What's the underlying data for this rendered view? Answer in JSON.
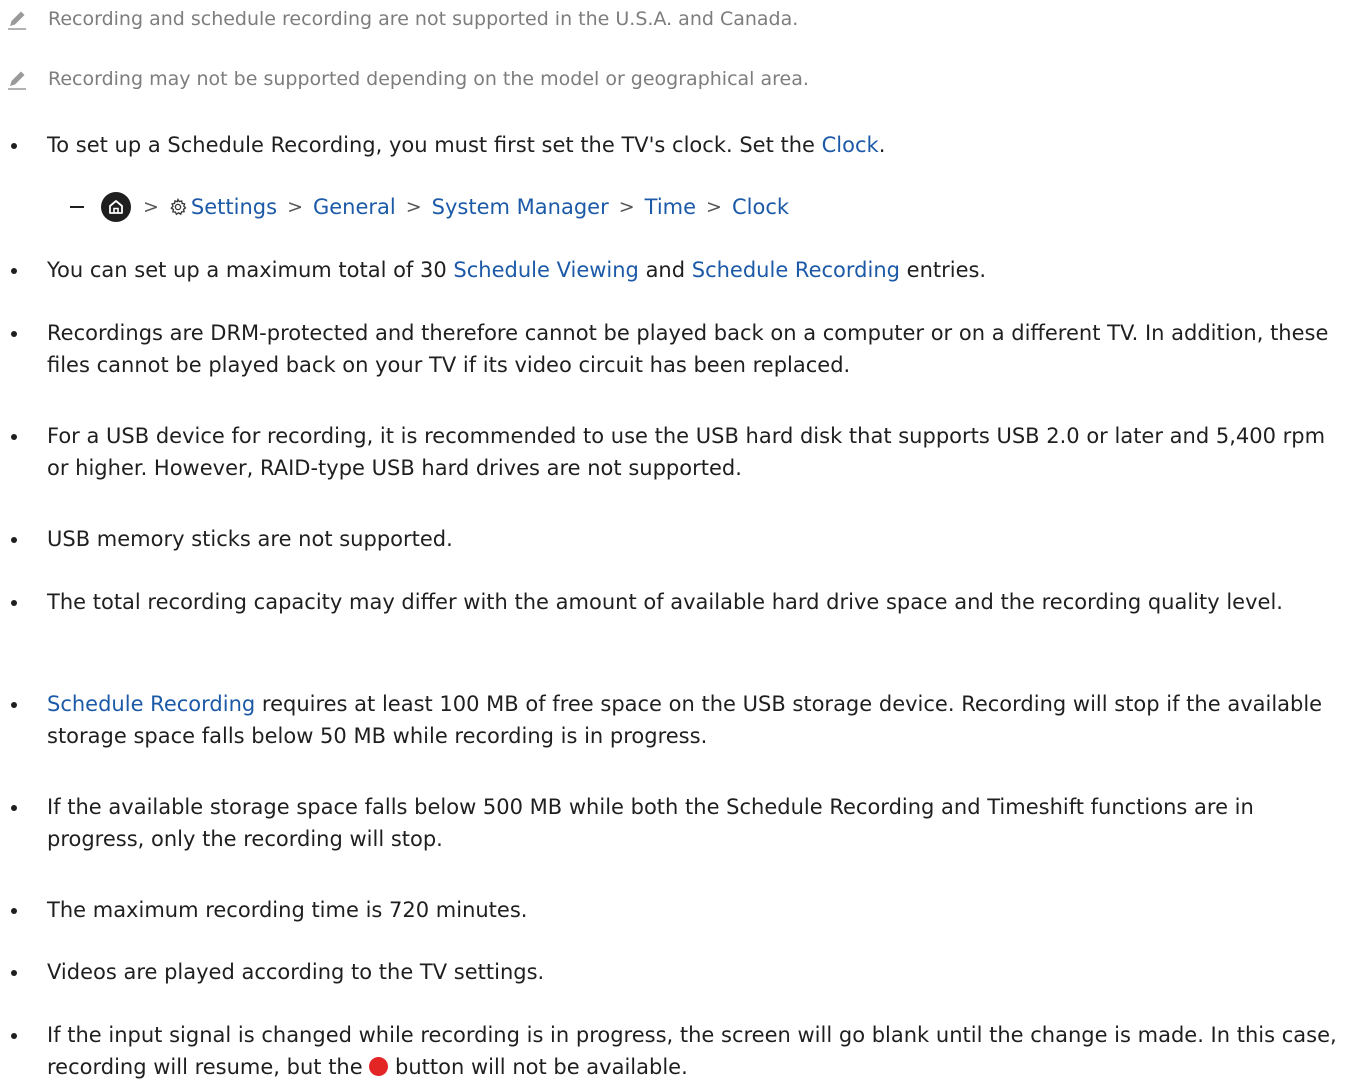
{
  "notes": [
    "Recording and schedule recording are not supported in the U.S.A. and Canada.",
    "Recording may not be supported depending on the model or geographical area."
  ],
  "b1": {
    "pre": "To set up a Schedule Recording, you must first set the TV's clock. Set the ",
    "link": "Clock",
    "post": "."
  },
  "path": {
    "settings": "Settings",
    "general": "General",
    "system_manager": "System Manager",
    "time": "Time",
    "clock": "Clock",
    "separator": ">"
  },
  "b2": {
    "pre": "You can set up a maximum total of 30 ",
    "link1": "Schedule Viewing",
    "mid": " and ",
    "link2": "Schedule Recording",
    "post": " entries."
  },
  "b3": "Recordings are DRM-protected and therefore cannot be played back on a computer or on a different TV. In addition, these files cannot be played back on your TV if its video circuit has been replaced.",
  "b4": "For a USB device for recording, it is recommended to use the USB hard disk that supports USB 2.0 or later and 5,400 rpm or higher. However, RAID-type USB hard drives are not supported.",
  "b5": "USB memory sticks are not supported.",
  "b6": "The total recording capacity may differ with the amount of available hard drive space and the recording quality level.",
  "b7": {
    "link": "Schedule Recording",
    "post": " requires at least 100 MB of free space on the USB storage device. Recording will stop if the available storage space falls below 50 MB while recording is in progress."
  },
  "b8": "If the available storage space falls below 500 MB while both the Schedule Recording and Timeshift functions are in progress, only the recording will stop.",
  "b9": "The maximum recording time is 720 minutes.",
  "b10": "Videos are played according to the TV settings.",
  "b11": {
    "pre": "If the input signal is changed while recording is in progress, the screen will go blank until the change is made. In this case, recording will resume, but the ",
    "post": " button will not be available."
  },
  "colors": {
    "link": "#1c5aa8",
    "note_text": "#7d7d7d",
    "record_button": "#e32526"
  },
  "icons": {
    "note": "pencil-icon",
    "home": "home-icon",
    "settings": "gear-icon",
    "record": "record-button-icon"
  }
}
